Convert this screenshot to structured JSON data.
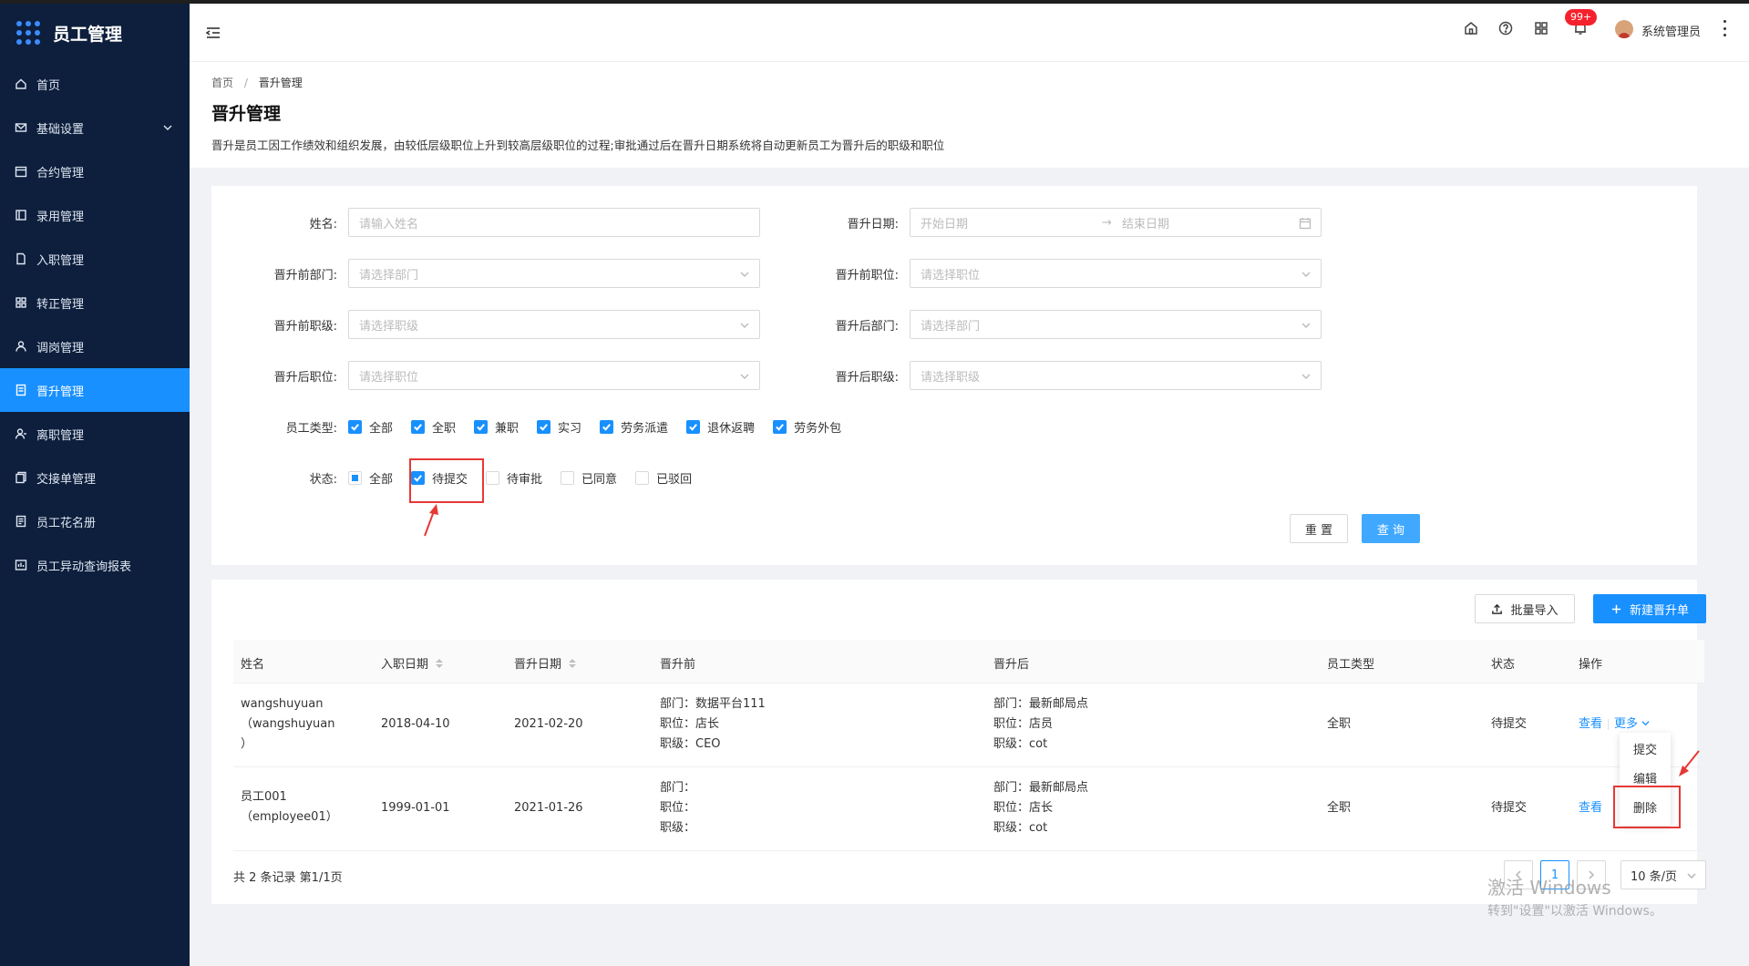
{
  "app": {
    "title": "员工管理"
  },
  "sidebar": {
    "items": [
      {
        "label": "首页",
        "icon": "home-icon"
      },
      {
        "label": "基础设置",
        "icon": "mail-icon"
      },
      {
        "label": "合约管理",
        "icon": "calendar-icon"
      },
      {
        "label": "录用管理",
        "icon": "book-icon"
      },
      {
        "label": "入职管理",
        "icon": "file-icon"
      },
      {
        "label": "转正管理",
        "icon": "grid-icon"
      },
      {
        "label": "调岗管理",
        "icon": "user-icon"
      },
      {
        "label": "晋升管理",
        "icon": "doc-icon"
      },
      {
        "label": "离职管理",
        "icon": "user-out-icon"
      },
      {
        "label": "交接单管理",
        "icon": "copy-icon"
      },
      {
        "label": "员工花名册",
        "icon": "roster-icon"
      },
      {
        "label": "员工异动查询报表",
        "icon": "report-icon"
      }
    ],
    "active_index": 7
  },
  "header": {
    "notification_badge": "99+",
    "user_name": "系统管理员"
  },
  "breadcrumb": {
    "home": "首页",
    "separator": "/",
    "current": "晋升管理"
  },
  "page": {
    "title": "晋升管理",
    "description": "晋升是员工因工作绩效和组织发展，由较低层级职位上升到较高层级职位的过程;审批通过后在晋升日期系统将自动更新员工为晋升后的职级和职位"
  },
  "search": {
    "name_label": "姓名:",
    "name_placeholder": "请输入姓名",
    "date_label": "晋升日期:",
    "date_start_placeholder": "开始日期",
    "date_arrow": "→",
    "date_end_placeholder": "结束日期",
    "pre_dept_label": "晋升前部门:",
    "pre_dept_placeholder": "请选择部门",
    "pre_pos_label": "晋升前职位:",
    "pre_pos_placeholder": "请选择职位",
    "pre_level_label": "晋升前职级:",
    "pre_level_placeholder": "请选择职级",
    "post_dept_label": "晋升后部门:",
    "post_dept_placeholder": "请选择部门",
    "post_pos_label": "晋升后职位:",
    "post_pos_placeholder": "请选择职位",
    "post_level_label": "晋升后职级:",
    "post_level_placeholder": "请选择职级",
    "emp_type_label": "员工类型:",
    "emp_types": [
      {
        "label": "全部",
        "checked": true
      },
      {
        "label": "全职",
        "checked": true
      },
      {
        "label": "兼职",
        "checked": true
      },
      {
        "label": "实习",
        "checked": true
      },
      {
        "label": "劳务派遣",
        "checked": true
      },
      {
        "label": "退休返聘",
        "checked": true
      },
      {
        "label": "劳务外包",
        "checked": true
      }
    ],
    "status_label": "状态:",
    "statuses": [
      {
        "label": "全部",
        "state": "indeterminate"
      },
      {
        "label": "待提交",
        "state": "checked"
      },
      {
        "label": "待审批",
        "state": "unchecked"
      },
      {
        "label": "已同意",
        "state": "unchecked"
      },
      {
        "label": "已驳回",
        "state": "unchecked"
      }
    ],
    "reset_label": "重 置",
    "query_label": "查 询"
  },
  "toolbar": {
    "import_label": "批量导入",
    "new_label": "新建晋升单"
  },
  "table": {
    "columns": [
      "姓名",
      "入职日期",
      "晋升日期",
      "晋升前",
      "晋升后",
      "员工类型",
      "状态",
      "操作"
    ],
    "rows": [
      {
        "name": "wangshuyuan",
        "name_sub": "（wangshuyuan",
        "name_sub2": "）",
        "join_date": "2018-04-10",
        "promo_date": "2021-02-20",
        "before": [
          "部门：数据平台111",
          "职位：店长",
          "职级：CEO"
        ],
        "after": [
          "部门：最新邮局点",
          "职位：店员",
          "职级：cot"
        ],
        "emp_type": "全职",
        "status": "待提交",
        "view": "查看",
        "more": "更多"
      },
      {
        "name": "员工001",
        "name_sub": "（employee01）",
        "join_date": "1999-01-01",
        "promo_date": "2021-01-26",
        "before": [
          "部门：",
          "职位：",
          "职级："
        ],
        "after": [
          "部门：最新邮局点",
          "职位：店长",
          "职级：cot"
        ],
        "emp_type": "全职",
        "status": "待提交",
        "view": "查看"
      }
    ],
    "dropdown": [
      "提交",
      "编辑",
      "删除"
    ]
  },
  "pagination": {
    "total_text": "共 2 条记录 第1/1页",
    "current_page": "1",
    "page_size": "10 条/页"
  },
  "watermark": {
    "line1": "激活 Windows",
    "line2": "转到\"设置\"以激活 Windows。"
  },
  "colors": {
    "primary": "#1890ff",
    "sidebar_bg": "#0d1f3c",
    "highlight": "#e53935"
  }
}
